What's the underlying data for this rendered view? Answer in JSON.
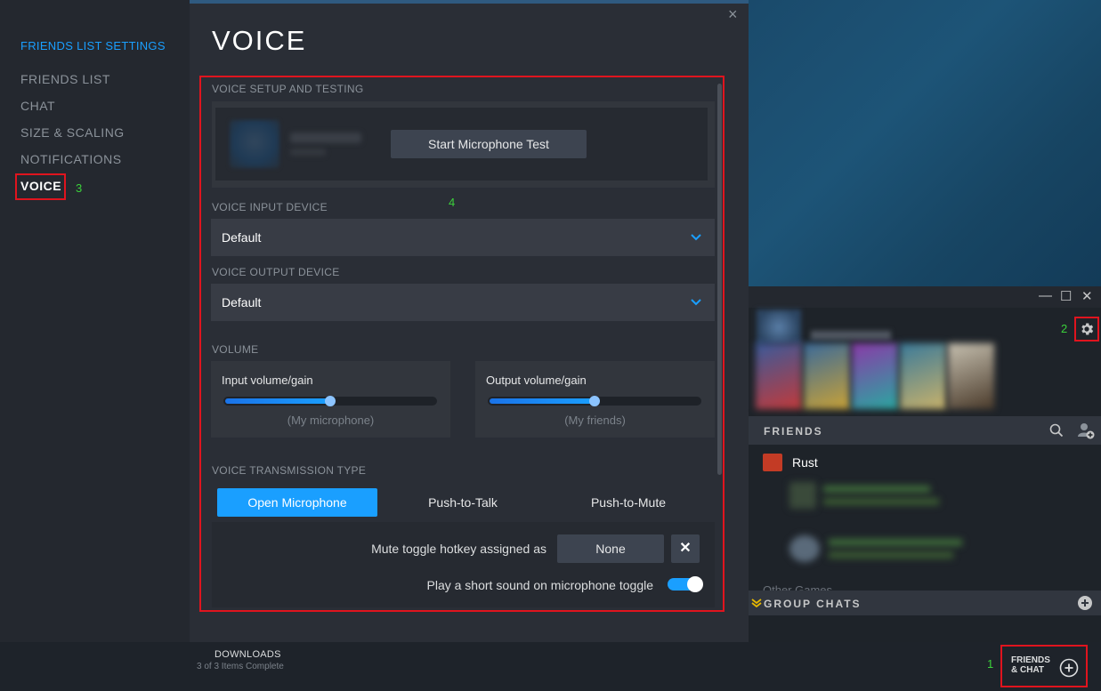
{
  "settings": {
    "nav_header": "FRIENDS LIST SETTINGS",
    "nav_items": [
      "FRIENDS LIST",
      "CHAT",
      "SIZE & SCALING",
      "NOTIFICATIONS",
      "VOICE"
    ],
    "page_title": "VOICE",
    "close_icon": "×"
  },
  "annotations": {
    "n1": "1",
    "n2": "2",
    "n3": "3",
    "n4": "4"
  },
  "voice": {
    "setup_label": "VOICE SETUP AND TESTING",
    "mic_test_label": "Start Microphone Test",
    "input_device_label": "VOICE INPUT DEVICE",
    "input_device_value": "Default",
    "output_device_label": "VOICE OUTPUT DEVICE",
    "output_device_value": "Default",
    "volume_label": "VOLUME",
    "input_volume": {
      "label": "Input volume/gain",
      "sub": "(My microphone)",
      "level": 0.5
    },
    "output_volume": {
      "label": "Output volume/gain",
      "sub": "(My friends)",
      "level": 0.5
    },
    "transmission_label": "VOICE TRANSMISSION TYPE",
    "tabs": [
      "Open Microphone",
      "Push-to-Talk",
      "Push-to-Mute"
    ],
    "active_tab": 0,
    "hotkey_label": "Mute toggle hotkey assigned as",
    "hotkey_value": "None",
    "hotkey_clear": "✕",
    "sound_label": "Play a short sound on microphone toggle",
    "sound_toggle_on": true
  },
  "friends": {
    "header": "FRIENDS",
    "game_name": "Rust",
    "other_games": "Other Games",
    "group_chats": "GROUP CHATS",
    "minimize": "—",
    "maximize": "☐",
    "close": "✕"
  },
  "bottom": {
    "downloads_title": "DOWNLOADS",
    "downloads_sub": "3 of 3 Items Complete",
    "friends_chat_line1": "FRIENDS",
    "friends_chat_line2": "& CHAT"
  },
  "colors": {
    "accent": "#1a9fff",
    "highlight_box": "#e0141e",
    "annotation": "#3bd13b"
  }
}
